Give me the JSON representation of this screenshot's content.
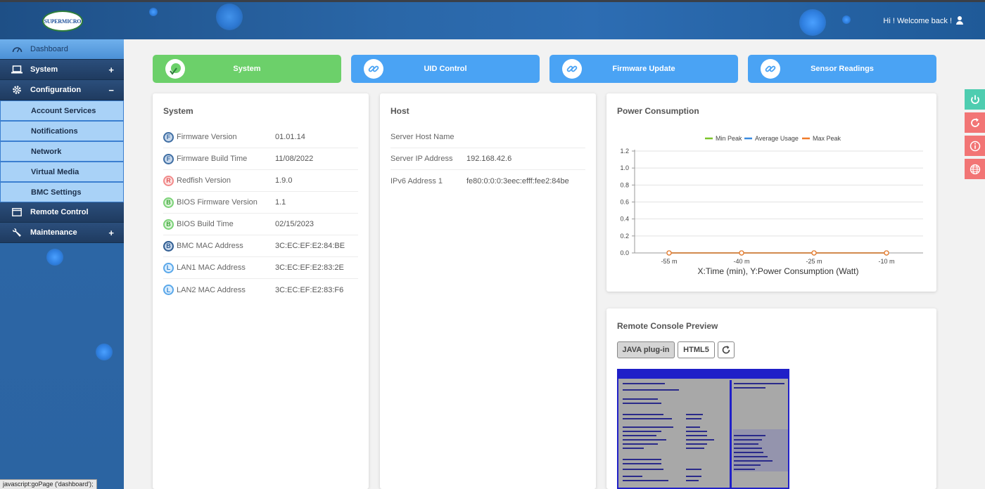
{
  "header": {
    "logo_text": "SUPERMICRO",
    "welcome": "Hi ! Welcome back !"
  },
  "sidebar": {
    "items": [
      {
        "label": "Dashboard",
        "icon": "dashboard-gauge-icon",
        "active": true
      },
      {
        "label": "System",
        "icon": "laptop-icon",
        "toggle": "+"
      },
      {
        "label": "Configuration",
        "icon": "gear-icon",
        "toggle": "−"
      },
      {
        "label": "Remote Control",
        "icon": "window-icon"
      },
      {
        "label": "Maintenance",
        "icon": "wrench-icon",
        "toggle": "+"
      }
    ],
    "sub_items": [
      "Account Services",
      "Notifications",
      "Network",
      "Virtual Media",
      "BMC Settings"
    ]
  },
  "status_bar": "javascript:goPage ('dashboard');",
  "quick_buttons": [
    {
      "label": "System",
      "icon": "check-leaf-icon",
      "color": "#6cd06a"
    },
    {
      "label": "UID Control",
      "icon": "link-icon",
      "color": "#4aa3f4"
    },
    {
      "label": "Firmware Update",
      "icon": "link-icon",
      "color": "#4aa3f4"
    },
    {
      "label": "Sensor Readings",
      "icon": "link-icon",
      "color": "#4aa3f4"
    }
  ],
  "system_card": {
    "title": "System",
    "rows": [
      {
        "badge": "F",
        "key": "Firmware Version",
        "value": "01.01.14"
      },
      {
        "badge": "F",
        "key": "Firmware Build Time",
        "value": "11/08/2022"
      },
      {
        "badge": "R",
        "key": "Redfish Version",
        "value": "1.9.0"
      },
      {
        "badge": "B",
        "key": "BIOS Firmware Version",
        "value": "1.1"
      },
      {
        "badge": "B",
        "key": "BIOS Build Time",
        "value": "02/15/2023"
      },
      {
        "badge": "B",
        "key": "BMC MAC Address",
        "value": "3C:EC:EF:E2:84:BE"
      },
      {
        "badge": "L",
        "key": "LAN1 MAC Address",
        "value": "3C:EC:EF:E2:83:2E"
      },
      {
        "badge": "L",
        "key": "LAN2 MAC Address",
        "value": "3C:EC:EF:E2:83:F6"
      }
    ]
  },
  "host_card": {
    "title": "Host",
    "rows": [
      {
        "key": "Server Host Name",
        "value": ""
      },
      {
        "key": "Server IP Address",
        "value": "192.168.42.6"
      },
      {
        "key": "IPv6 Address 1",
        "value": "fe80:0:0:0:3eec:efff:fee2:84be"
      }
    ]
  },
  "power_card": {
    "title": "Power Consumption"
  },
  "chart_data": {
    "type": "line",
    "x": [
      "-55 m",
      "-40 m",
      "-25 m",
      "-10 m"
    ],
    "series": [
      {
        "name": "Min Peak",
        "color": "#7cc42a",
        "values": [
          0,
          0,
          0,
          0
        ]
      },
      {
        "name": "Average Usage",
        "color": "#3a8be0",
        "values": [
          0,
          0,
          0,
          0
        ]
      },
      {
        "name": "Max Peak",
        "color": "#f07c2a",
        "values": [
          0,
          0,
          0,
          0
        ]
      }
    ],
    "yticks": [
      "0.0",
      "0.2",
      "0.4",
      "0.6",
      "0.8",
      "1.0",
      "1.2"
    ],
    "ylim": [
      0,
      1.2
    ],
    "xlabel": "X:Time (min), Y:Power Consumption (Watt)",
    "legend_position": "top-center",
    "grid": true
  },
  "console_card": {
    "title": "Remote Console Preview",
    "java_label": "JAVA plug-in",
    "html5_label": "HTML5",
    "refresh_icon": "refresh-icon"
  },
  "side_tools": [
    {
      "icon": "power-icon",
      "color": "#4ecdb0"
    },
    {
      "icon": "reset-icon",
      "color": "#f27575"
    },
    {
      "icon": "info-icon",
      "color": "#f27575"
    },
    {
      "icon": "globe-icon",
      "color": "#f27575"
    }
  ]
}
